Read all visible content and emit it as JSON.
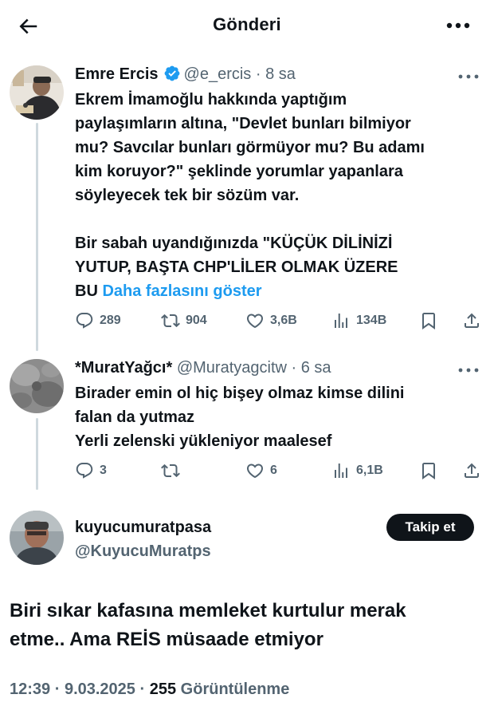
{
  "header": {
    "title": "Gönderi",
    "back_icon": "arrow-left-icon",
    "more_icon": "more-horizontal-icon"
  },
  "tweets": [
    {
      "name": "Emre Ercis",
      "verified": true,
      "handle": "@e_ercis",
      "separator": "·",
      "time": "8 sa",
      "text_lines": [
        "Ekrem İmamoğlu hakkında yaptığım",
        "paylaşımların altına, \"Devlet bunları bilmiyor",
        "mu? Savcılar bunları görmüyor mu? Bu adamı",
        "kim koruyor?\" şeklinde yorumlar yapanlara",
        "söyleyecek tek bir sözüm var."
      ],
      "text_lines_2": [
        "Bir sabah uyandığınızda \"KÜÇÜK DİLİNİZİ",
        "YUTUP, BAŞTA CHP'LİLER OLMAK ÜZERE"
      ],
      "last_line_prefix": "BU",
      "show_more": "Daha fazlasını göster",
      "replies": "289",
      "reposts": "904",
      "likes": "3,6B",
      "views": "134B"
    },
    {
      "name": "*MuratYağcı*",
      "verified": false,
      "handle": "@Muratyagcitw",
      "separator": "·",
      "time": "6 sa",
      "text_lines": [
        "Birader emin ol hiç bişey olmaz kimse dilini",
        "falan da yutmaz",
        "Yerli zelenski yükleniyor maalesef"
      ],
      "replies": "3",
      "reposts": "",
      "likes": "6",
      "views": "6,1B"
    }
  ],
  "main_post": {
    "name": "kuyucumuratpasa",
    "handle": "@KuyucuMuratps",
    "follow_label": "Takip et",
    "text_lines": [
      "Biri sıkar kafasına memleket kurtulur merak",
      "etme.. Ama REİS müsaade etmiyor"
    ],
    "time": "12:39",
    "date": "9.03.2025",
    "separator": "·",
    "view_count": "255",
    "view_label": "Görüntülenme"
  },
  "colors": {
    "text": "#0f1419",
    "secondary": "#536471",
    "link": "#1d9bf0",
    "thread_line": "#cfd9de",
    "follow_bg": "#0f1419"
  }
}
